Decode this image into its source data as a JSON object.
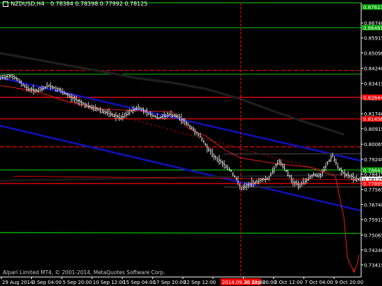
{
  "header": {
    "symbol": "NZDUSD,H4",
    "ohlc": "0.78384 0.78398 0.77992 0.78125"
  },
  "copyright": "Alpari Limited MT4, © 2001-2014, MetaQuotes Software Corp.",
  "colors": {
    "background": "#000000",
    "axis": "#ffffff",
    "price": "#ffffff",
    "green_level": "#00b000",
    "red_level": "#ff0000",
    "channel": "#1010b8",
    "moving_average": "#202020",
    "indicator": "#ff2020",
    "label_green": "#00a000",
    "label_red": "#ff0000"
  },
  "chart_data": {
    "type": "line",
    "symbol": "NZDUSD",
    "timeframe": "H4",
    "ylim": [
      0.7275,
      0.8785
    ],
    "y_ticks": [
      "0.86740",
      "0.85915",
      "0.85090",
      "0.84240",
      "0.83415",
      "0.82590",
      "0.81740",
      "0.80915",
      "0.80065",
      "0.79240",
      "0.78415",
      "0.77565",
      "0.76740",
      "0.75915",
      "0.75065",
      "0.74240",
      "0.73415"
    ],
    "x_ticks": [
      "29 Aug 2014",
      "3 Sep 04:00",
      "5 Sep 20:00",
      "10 Sep 12:00",
      "15 Sep 04:00",
      "17 Sep 20:00",
      "22 Sep 12:00",
      "2014.09.26 23:00",
      "30 Sep 20:00",
      "2 Oct 12:00",
      "7 Oct 04:00",
      "9 Oct 20:00"
    ],
    "bar_count": 210,
    "highlighted_x_label": "2014.09.26 23:00",
    "highlighted_bar_index": 140,
    "price_labels": [
      {
        "value": 0.87617,
        "text": "0.87617",
        "color": "green"
      },
      {
        "value": 0.86481,
        "text": "0.86481",
        "color": "green"
      },
      {
        "value": 0.82644,
        "text": "0.82644",
        "color": "red"
      },
      {
        "value": 0.81456,
        "text": "0.81456",
        "color": "red"
      },
      {
        "value": 0.78642,
        "text": "0.78642",
        "color": "green"
      },
      {
        "value": 0.78125,
        "text": "0.78125",
        "color": "white"
      },
      {
        "value": 0.77899,
        "text": "0.77899",
        "color": "red"
      }
    ],
    "levels": [
      {
        "value": 0.8785,
        "color": "green",
        "style": "solid"
      },
      {
        "value": 0.8648,
        "color": "green",
        "style": "solid"
      },
      {
        "value": 0.8392,
        "color": "green",
        "style": "solid"
      },
      {
        "value": 0.8413,
        "color": "red",
        "style": "dashed"
      },
      {
        "value": 0.82644,
        "color": "red",
        "style": "solid"
      },
      {
        "value": 0.81456,
        "color": "red",
        "style": "solid"
      },
      {
        "value": 0.7992,
        "color": "red",
        "style": "dashed"
      },
      {
        "value": 0.78642,
        "color": "green",
        "style": "solid"
      },
      {
        "value": 0.77899,
        "color": "red",
        "style": "solid"
      }
    ],
    "channel_lines": [
      {
        "x0": 0,
        "y0": 0.8372,
        "x1": 210,
        "y1": 0.7915,
        "color": "blue"
      },
      {
        "x0": 0,
        "y0": 0.8108,
        "x1": 210,
        "y1": 0.764,
        "color": "blue"
      }
    ],
    "extra_lines": [
      {
        "x0": 0,
        "y0": 0.7805,
        "x1": 210,
        "y1": 0.784,
        "color": "black_thick"
      },
      {
        "x0": 8,
        "y0": 0.783,
        "x1": 210,
        "y1": 0.781,
        "color": "red_thin"
      },
      {
        "x0": 10,
        "y0": 0.8312,
        "x1": 206,
        "y1": 0.7815,
        "color": "red_dotted"
      },
      {
        "x0": 0,
        "y0": 0.752,
        "x1": 210,
        "y1": 0.7515,
        "color": "green_thin"
      },
      {
        "x0": 130,
        "y0": 0.7952,
        "x1": 210,
        "y1": 0.7954,
        "color": "black_box"
      },
      {
        "x0": 130,
        "y0": 0.777,
        "x1": 210,
        "y1": 0.7772,
        "color": "black_box"
      }
    ],
    "moving_average": [
      {
        "x": 0,
        "y": 0.8508
      },
      {
        "x": 20,
        "y": 0.8474
      },
      {
        "x": 40,
        "y": 0.844
      },
      {
        "x": 60,
        "y": 0.8405
      },
      {
        "x": 80,
        "y": 0.837
      },
      {
        "x": 100,
        "y": 0.8345
      },
      {
        "x": 120,
        "y": 0.831
      },
      {
        "x": 140,
        "y": 0.8255
      },
      {
        "x": 160,
        "y": 0.8185
      },
      {
        "x": 180,
        "y": 0.812
      },
      {
        "x": 200,
        "y": 0.806
      }
    ],
    "indicator_line": [
      {
        "x": 0,
        "y": 0.833
      },
      {
        "x": 20,
        "y": 0.83
      },
      {
        "x": 40,
        "y": 0.824
      },
      {
        "x": 60,
        "y": 0.82
      },
      {
        "x": 80,
        "y": 0.819
      },
      {
        "x": 100,
        "y": 0.8185
      },
      {
        "x": 110,
        "y": 0.809
      },
      {
        "x": 120,
        "y": 0.805
      },
      {
        "x": 130,
        "y": 0.798
      },
      {
        "x": 140,
        "y": 0.793
      },
      {
        "x": 160,
        "y": 0.79
      },
      {
        "x": 180,
        "y": 0.788
      },
      {
        "x": 195,
        "y": 0.783
      },
      {
        "x": 200,
        "y": 0.76
      },
      {
        "x": 202,
        "y": 0.738
      },
      {
        "x": 206,
        "y": 0.73
      },
      {
        "x": 208,
        "y": 0.736
      }
    ],
    "price_path": [
      {
        "x": 0,
        "y": 0.837
      },
      {
        "x": 6,
        "y": 0.8385
      },
      {
        "x": 10,
        "y": 0.836
      },
      {
        "x": 16,
        "y": 0.831
      },
      {
        "x": 22,
        "y": 0.83
      },
      {
        "x": 28,
        "y": 0.833
      },
      {
        "x": 34,
        "y": 0.8305
      },
      {
        "x": 40,
        "y": 0.827
      },
      {
        "x": 46,
        "y": 0.824
      },
      {
        "x": 52,
        "y": 0.821
      },
      {
        "x": 58,
        "y": 0.8195
      },
      {
        "x": 64,
        "y": 0.817
      },
      {
        "x": 70,
        "y": 0.815
      },
      {
        "x": 76,
        "y": 0.819
      },
      {
        "x": 80,
        "y": 0.821
      },
      {
        "x": 86,
        "y": 0.8175
      },
      {
        "x": 92,
        "y": 0.815
      },
      {
        "x": 98,
        "y": 0.817
      },
      {
        "x": 104,
        "y": 0.8155
      },
      {
        "x": 110,
        "y": 0.8105
      },
      {
        "x": 116,
        "y": 0.805
      },
      {
        "x": 120,
        "y": 0.799
      },
      {
        "x": 124,
        "y": 0.794
      },
      {
        "x": 128,
        "y": 0.791
      },
      {
        "x": 134,
        "y": 0.786
      },
      {
        "x": 138,
        "y": 0.78
      },
      {
        "x": 140,
        "y": 0.776
      },
      {
        "x": 146,
        "y": 0.779
      },
      {
        "x": 152,
        "y": 0.781
      },
      {
        "x": 156,
        "y": 0.782
      },
      {
        "x": 160,
        "y": 0.789
      },
      {
        "x": 162,
        "y": 0.791
      },
      {
        "x": 166,
        "y": 0.786
      },
      {
        "x": 170,
        "y": 0.78
      },
      {
        "x": 174,
        "y": 0.778
      },
      {
        "x": 178,
        "y": 0.781
      },
      {
        "x": 182,
        "y": 0.784
      },
      {
        "x": 186,
        "y": 0.783
      },
      {
        "x": 190,
        "y": 0.79
      },
      {
        "x": 193,
        "y": 0.7945
      },
      {
        "x": 196,
        "y": 0.788
      },
      {
        "x": 200,
        "y": 0.784
      },
      {
        "x": 204,
        "y": 0.7825
      },
      {
        "x": 208,
        "y": 0.7812
      }
    ]
  }
}
